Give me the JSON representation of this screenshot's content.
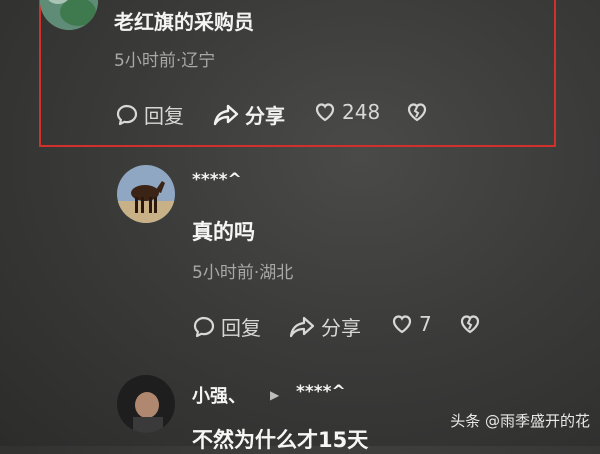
{
  "comments": [
    {
      "username": "老红旗的采购员",
      "meta": "5小时前·辽宁",
      "actions": {
        "reply": "回复",
        "share": "分享",
        "likes": "248"
      }
    },
    {
      "username": "****^",
      "content": "真的吗",
      "meta": "5小时前·湖北",
      "actions": {
        "reply": "回复",
        "share": "分享",
        "likes": "7"
      }
    },
    {
      "username": "小强、",
      "reply_to": "****^",
      "content": "不然为什么才15天"
    }
  ],
  "watermark": "头条 @雨季盛开的花"
}
